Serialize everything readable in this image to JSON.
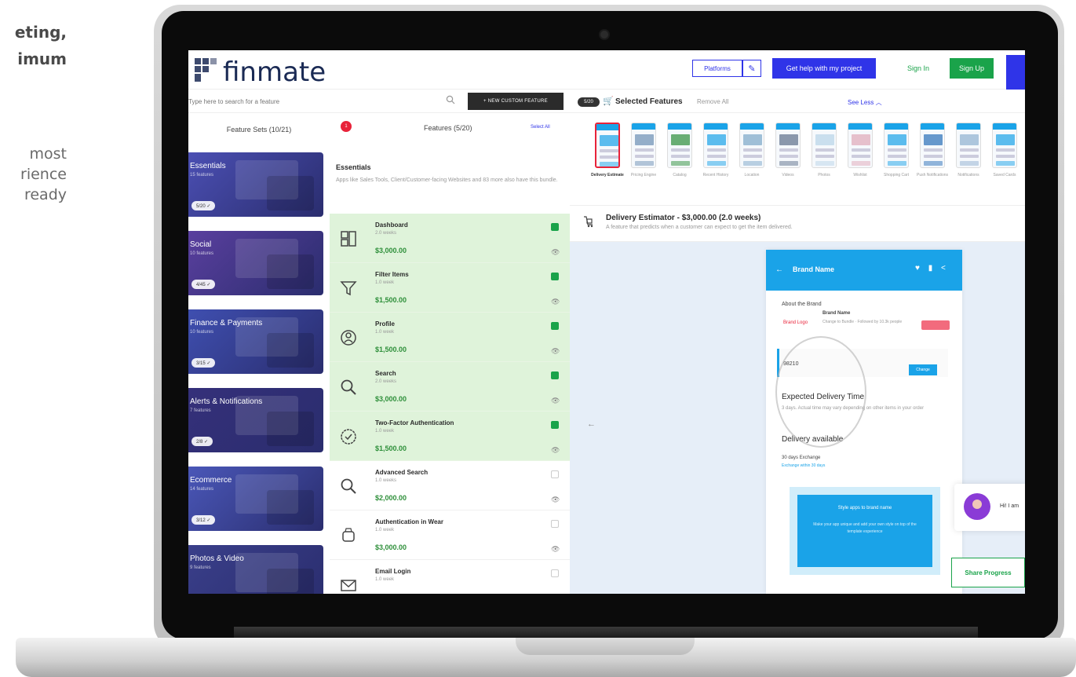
{
  "marketing": {
    "heading_line1": "eting,",
    "heading_line2": "imum",
    "body_line1": "most",
    "body_line2": "rience",
    "body_line3": "ready"
  },
  "app": {
    "logo_text": "finmate",
    "brand_color": "#3d4a6e"
  },
  "topbar": {
    "platforms_label": "Platforms",
    "edit_icon": "pencil-icon",
    "help_label": "Get help with my project",
    "signin_label": "Sign In",
    "signup_label": "Sign Up",
    "accent": "#2f34e8",
    "green": "#1aa34a"
  },
  "search": {
    "placeholder": "Type here to search for a feature",
    "custom_feature_label": "+ NEW CUSTOM FEATURE"
  },
  "feature_sets": {
    "header": "Feature Sets (10/21)",
    "items": [
      {
        "name": "Essentials",
        "sub": "15 features",
        "badge": "5/20 ✓",
        "color": "#4b4fb3"
      },
      {
        "name": "Social",
        "sub": "10 features",
        "badge": "4/45 ✓",
        "color": "#5a3f9e"
      },
      {
        "name": "Finance & Payments",
        "sub": "10 features",
        "badge": "3/15 ✓",
        "color": "#3f4fb0"
      },
      {
        "name": "Alerts & Notifications",
        "sub": "7 features",
        "badge": "2/8 ✓",
        "color": "#35307a"
      },
      {
        "name": "Ecommerce",
        "sub": "14 features",
        "badge": "3/12 ✓",
        "color": "#4a57b8"
      },
      {
        "name": "Photos & Video",
        "sub": "9 features",
        "badge": "",
        "color": "#3a3f8a"
      }
    ]
  },
  "features": {
    "notification_count": "1",
    "header": "Features (5/20)",
    "select_all": "Select All",
    "bundle_title": "Essentials",
    "bundle_desc": "Apps like Sales Tools, Client/Customer-facing Websites and 83 more also have this bundle.",
    "items": [
      {
        "name": "Dashboard",
        "duration": "2.0 weeks",
        "price": "$3,000.00",
        "selected": true,
        "icon": "dashboard-icon"
      },
      {
        "name": "Filter Items",
        "duration": "1.0 week",
        "price": "$1,500.00",
        "selected": true,
        "icon": "filter-icon"
      },
      {
        "name": "Profile",
        "duration": "1.0 week",
        "price": "$1,500.00",
        "selected": true,
        "icon": "profile-icon"
      },
      {
        "name": "Search",
        "duration": "2.0 weeks",
        "price": "$3,000.00",
        "selected": true,
        "icon": "search-icon"
      },
      {
        "name": "Two-Factor Authentication",
        "duration": "1.0 week",
        "price": "$1,500.00",
        "selected": true,
        "icon": "check-circle-icon"
      },
      {
        "name": "Advanced Search",
        "duration": "1.0 weeks",
        "price": "$2,000.00",
        "selected": false,
        "icon": "search-icon"
      },
      {
        "name": "Authentication in Wear",
        "duration": "1.0 week",
        "price": "$3,000.00",
        "selected": false,
        "icon": "watch-icon"
      },
      {
        "name": "Email Login",
        "duration": "1.0 week",
        "price": "",
        "selected": false,
        "icon": "mail-icon"
      }
    ]
  },
  "selected": {
    "count": "5/20",
    "title": "Selected Features",
    "remove_all": "Remove All",
    "see_less": "See Less",
    "thumbnails": [
      {
        "label": "Delivery Estimate",
        "active": true
      },
      {
        "label": "Pricing Engine",
        "active": false
      },
      {
        "label": "Catalog",
        "active": false
      },
      {
        "label": "Recent History",
        "active": false
      },
      {
        "label": "Location",
        "active": false
      },
      {
        "label": "Videos",
        "active": false
      },
      {
        "label": "Photos",
        "active": false
      },
      {
        "label": "Wishlist",
        "active": false
      },
      {
        "label": "Shopping Cart",
        "active": false
      },
      {
        "label": "Push Notifications",
        "active": false
      },
      {
        "label": "Notifications",
        "active": false
      },
      {
        "label": "Saved Cards",
        "active": false
      }
    ]
  },
  "estimator": {
    "title": "Delivery Estimator - $3,000.00 (2.0 weeks)",
    "desc": "A feature that predicts when a customer can expect to get the item delivered."
  },
  "preview": {
    "brand_name": "Brand Name",
    "about": "About the Brand",
    "logo": "Brand Logo",
    "brand_title": "Brand Name",
    "brand_lines": "Change to Bundle · Followed by 10.3k people",
    "pincode": "98210",
    "check_label": "Change",
    "expected": "Expected Delivery Time",
    "expected_sub": "3 days. Actual time may vary depending on other items in your order",
    "available": "Delivery available",
    "days": "30 days Exchange",
    "exchange": "Exchange within 30 days",
    "card_title": "Style apps to brand name",
    "card_text": "Make your app unique and add your own style on top of the template experience"
  },
  "chat": {
    "greeting": "Hi! I am"
  },
  "share": {
    "label": "Share Progress"
  }
}
